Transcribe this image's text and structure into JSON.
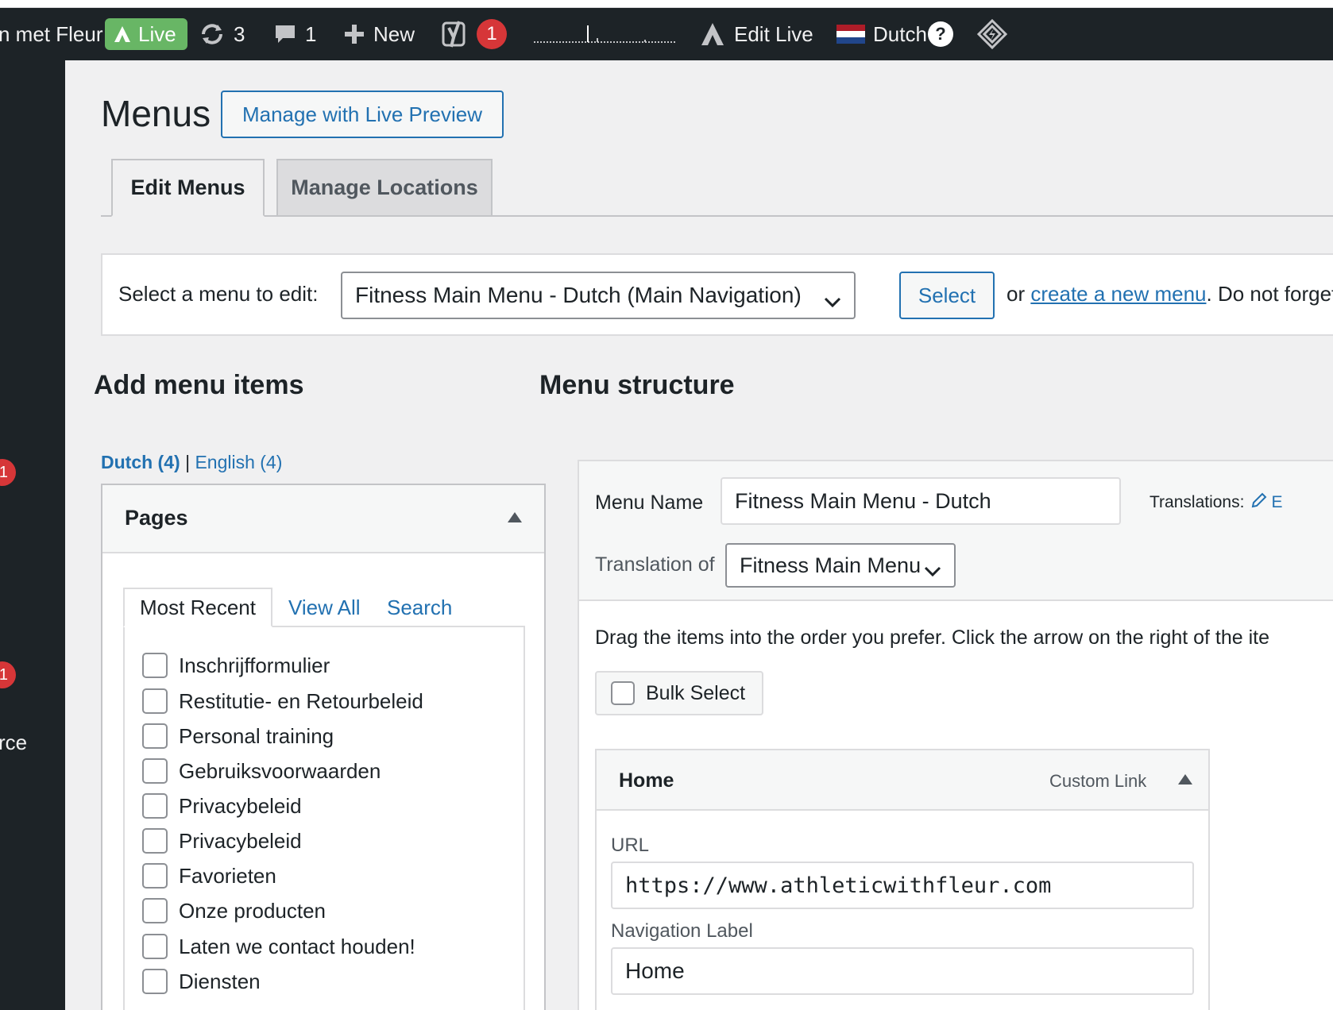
{
  "admin_bar": {
    "site_name": "n met Fleur",
    "live_label": "Live",
    "updates_count": "3",
    "comments_count": "1",
    "new_label": "New",
    "yoast_count": "1",
    "edit_live_label": "Edit Live",
    "language_label": "Dutch",
    "help_label": "?"
  },
  "sidebar": {
    "badge_1": "1",
    "badge_2": "1",
    "partial_label": "rce"
  },
  "page": {
    "title": "Menus",
    "live_preview_button": "Manage with Live Preview"
  },
  "tabs": {
    "edit_menus": "Edit Menus",
    "manage_locations": "Manage Locations"
  },
  "menu_select_bar": {
    "label": "Select a menu to edit:",
    "selected_menu": "Fitness Main Menu - Dutch (Main Navigation)",
    "select_button": "Select",
    "text_or": "or",
    "create_link": "create a new menu",
    "text_after": ". Do not forget t"
  },
  "add_items": {
    "heading": "Add menu items",
    "lang_dutch": "Dutch (4)",
    "lang_sep": "|",
    "lang_english": "English (4)",
    "pages_title": "Pages",
    "tab_most_recent": "Most Recent",
    "tab_view_all": "View All",
    "tab_search": "Search",
    "pages": [
      "Inschrijfformulier",
      "Restitutie- en Retourbeleid",
      "Personal training",
      "Gebruiksvoorwaarden",
      "Privacybeleid",
      "Privacybeleid",
      "Favorieten",
      "Onze producten",
      "Laten we contact houden!",
      "Diensten"
    ]
  },
  "structure": {
    "heading": "Menu structure",
    "menu_name_label": "Menu Name",
    "menu_name_value": "Fitness Main Menu - Dutch",
    "translations_label": "Translations:",
    "translations_edit": "E",
    "translation_of_label": "Translation of",
    "translation_of_value": "Fitness Main Menu",
    "instructions": "Drag the items into the order you prefer. Click the arrow on the right of the ite",
    "bulk_select": "Bulk Select",
    "item": {
      "title": "Home",
      "type": "Custom Link",
      "url_label": "URL",
      "url_value": "https://www.athleticwithfleur.com",
      "nav_label": "Navigation Label",
      "nav_value": "Home"
    }
  },
  "colors": {
    "admin_bar_bg": "#1d2327",
    "live_green": "#68b665",
    "notification_red": "#d63638",
    "link_blue": "#2271b1",
    "page_bg": "#f0f0f1"
  }
}
